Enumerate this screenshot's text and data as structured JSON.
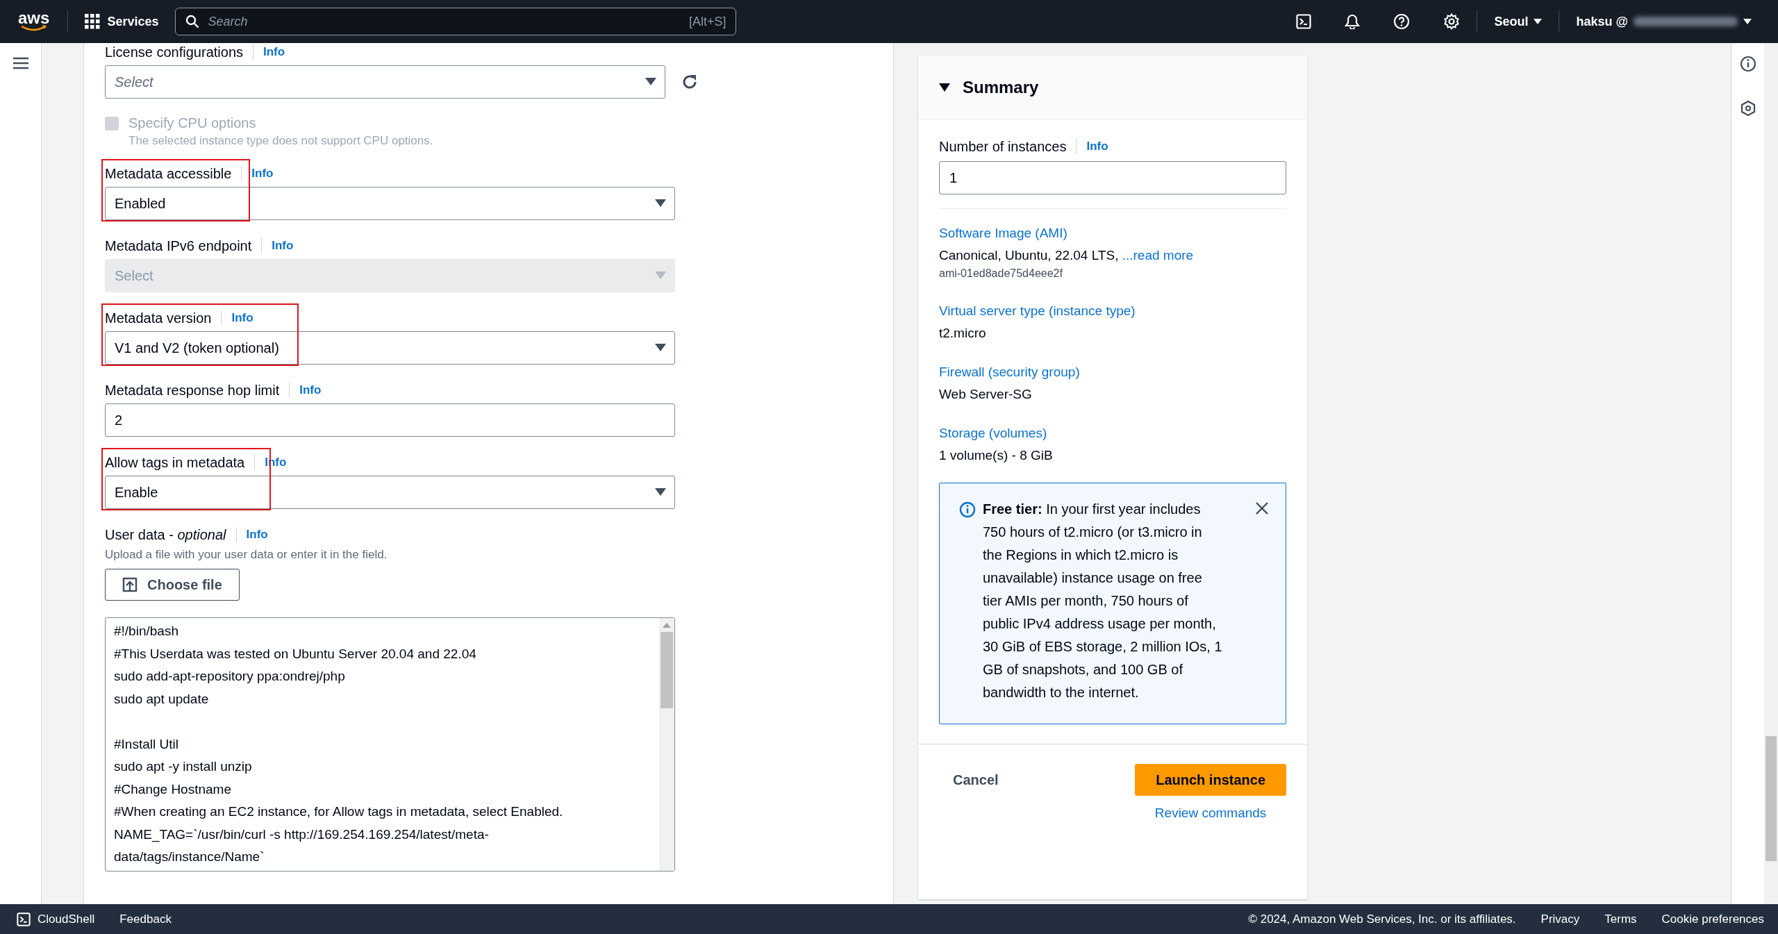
{
  "top_bar": {
    "logo": "aws",
    "services": "Services",
    "search": {
      "placeholder": "Search",
      "shortcut": "[Alt+S]"
    },
    "region": "Seoul",
    "user": "haksu @"
  },
  "form": {
    "fields": [
      {
        "kind": "select",
        "label": "License configurations",
        "info": "Info",
        "placeholder": "Select",
        "disabled": false,
        "refresh": true
      },
      {
        "kind": "checkbox",
        "label": "Specify CPU options",
        "description": "The selected instance type does not support CPU options.",
        "checked": false,
        "disabled": true
      },
      {
        "kind": "select",
        "label": "Metadata accessible",
        "info": "Info",
        "value": "Enabled",
        "disabled": false,
        "highlighted": true
      },
      {
        "kind": "select",
        "label": "Metadata IPv6 endpoint",
        "info": "Info",
        "placeholder": "Select",
        "disabled": true
      },
      {
        "kind": "select",
        "label": "Metadata version",
        "info": "Info",
        "value": "V1 and V2 (token optional)",
        "disabled": false,
        "highlighted": true
      },
      {
        "kind": "input",
        "label": "Metadata response hop limit",
        "info": "Info",
        "value": "2"
      },
      {
        "kind": "select",
        "label": "Allow tags in metadata",
        "info": "Info",
        "value": "Enable",
        "disabled": false,
        "highlighted": true
      },
      {
        "kind": "upload",
        "label": "User data - *optional*",
        "info": "Info",
        "description": "Upload a file with your user data or enter it in the field.",
        "button": "Choose file"
      },
      {
        "kind": "textarea",
        "value": "#!/bin/bash\n#This Userdata was tested on Ubuntu Server 20.04 and 22.04\nsudo add-apt-repository ppa:ondrej/php\nsudo apt update\n\n#Install Util\nsudo apt -y install unzip\n#Change Hostname\n#When creating an EC2 instance, for Allow tags in metadata, select Enabled.\nNAME_TAG=`/usr/bin/curl -s http://169.254.169.254/latest/meta-\ndata/tags/instance/Name`"
      }
    ]
  },
  "summary": {
    "title": "Summary",
    "expanded": true,
    "instances": {
      "label": "Number of instances",
      "info": "Info",
      "value": "1"
    },
    "items": [
      {
        "title": "Software Image (AMI)",
        "value": "Canonical, Ubuntu, 22.04 LTS, ",
        "link": "...read more",
        "detail": "ami-01ed8ade75d4eee2f"
      },
      {
        "title": "Virtual server type (instance type)",
        "value": "t2.micro"
      },
      {
        "title": "Firewall (security group)",
        "value": "Web Server-SG"
      },
      {
        "title": "Storage (volumes)",
        "value": "1 volume(s) - 8 GiB"
      }
    ],
    "alert": {
      "text": "**Free tier:** In your first year includes 750 hours of t2.micro (or t3.micro in the Regions in which t2.micro is unavailable) instance usage on free tier AMIs per month, 750 hours of public IPv4 address usage per month, 30 GiB of EBS storage, 2 million IOs, 1 GB of snapshots, and 100 GB of bandwidth to the internet."
    },
    "cancel": "Cancel",
    "launch": "Launch instance",
    "review": "Review commands"
  },
  "footer": {
    "cloudshell": "CloudShell",
    "feedback": "Feedback",
    "copyright": "© 2024, Amazon Web Services, Inc. or its affiliates.",
    "links": [
      "Privacy",
      "Terms",
      "Cookie preferences"
    ]
  }
}
